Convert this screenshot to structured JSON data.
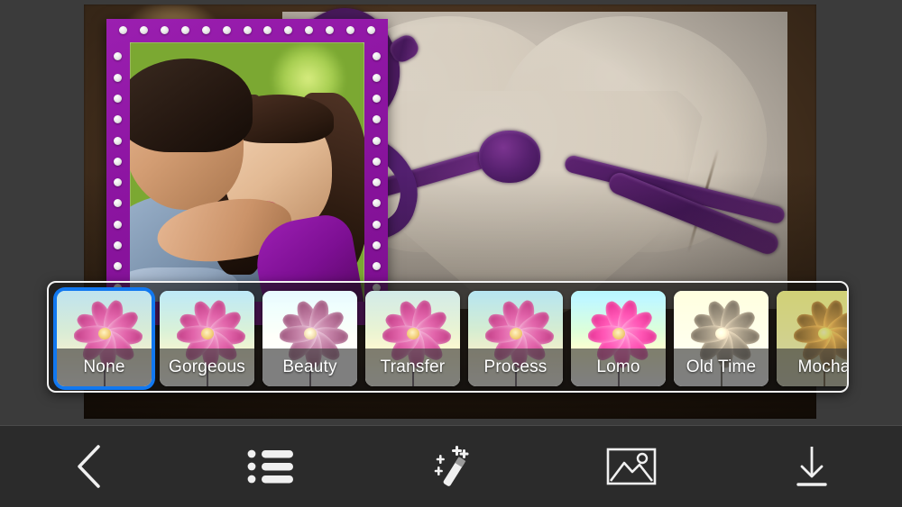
{
  "app": {
    "screen_name": "Photo Frame Editor — Filter Selection",
    "background_color": "#3b3b3b",
    "toolbar_color": "#2b2b2b",
    "selection_color": "#1178f0",
    "frame_color": "#8d15a2"
  },
  "canvas": {
    "photo_description": "Heart-shaped stone tied with a purple yarn bow resting on pebbles",
    "frame_description": "Purple photo frame with white dot studs containing a photo of a couple kissing",
    "frame_dot_count": 46
  },
  "filter_strip": {
    "selected_index": 0,
    "filters": [
      {
        "label": "None",
        "key": "none",
        "class": "f-none"
      },
      {
        "label": "Gorgeous",
        "key": "gorgeous",
        "class": "f-gorgeous"
      },
      {
        "label": "Beauty",
        "key": "beauty",
        "class": "f-beauty"
      },
      {
        "label": "Transfer",
        "key": "transfer",
        "class": "f-transfer"
      },
      {
        "label": "Process",
        "key": "process",
        "class": "f-process"
      },
      {
        "label": "Lomo",
        "key": "lomo",
        "class": "f-lomo"
      },
      {
        "label": "Old Time",
        "key": "oldtime",
        "class": "f-oldtime"
      },
      {
        "label": "Mocha",
        "key": "mocha",
        "class": "f-mocha"
      }
    ]
  },
  "toolbar": {
    "buttons": [
      {
        "name": "back-button",
        "icon": "back-chevron-icon",
        "label": ""
      },
      {
        "name": "frames-button",
        "icon": "list-icon",
        "label": ""
      },
      {
        "name": "effects-button",
        "icon": "magic-wand-icon",
        "label": ""
      },
      {
        "name": "gallery-button",
        "icon": "image-icon",
        "label": ""
      },
      {
        "name": "save-button",
        "icon": "download-icon",
        "label": ""
      }
    ]
  }
}
